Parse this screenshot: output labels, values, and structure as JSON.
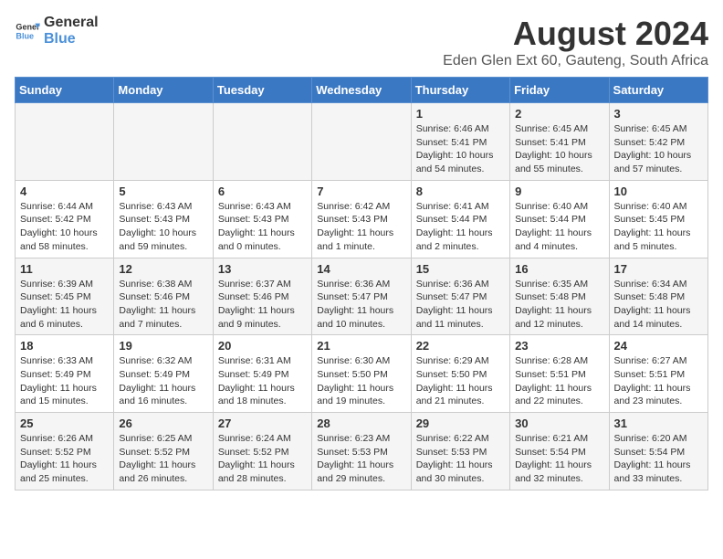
{
  "header": {
    "logo_general": "General",
    "logo_blue": "Blue",
    "month_title": "August 2024",
    "location": "Eden Glen Ext 60, Gauteng, South Africa"
  },
  "days_of_week": [
    "Sunday",
    "Monday",
    "Tuesday",
    "Wednesday",
    "Thursday",
    "Friday",
    "Saturday"
  ],
  "weeks": [
    [
      {
        "day": "",
        "info": ""
      },
      {
        "day": "",
        "info": ""
      },
      {
        "day": "",
        "info": ""
      },
      {
        "day": "",
        "info": ""
      },
      {
        "day": "1",
        "info": "Sunrise: 6:46 AM\nSunset: 5:41 PM\nDaylight: 10 hours and 54 minutes."
      },
      {
        "day": "2",
        "info": "Sunrise: 6:45 AM\nSunset: 5:41 PM\nDaylight: 10 hours and 55 minutes."
      },
      {
        "day": "3",
        "info": "Sunrise: 6:45 AM\nSunset: 5:42 PM\nDaylight: 10 hours and 57 minutes."
      }
    ],
    [
      {
        "day": "4",
        "info": "Sunrise: 6:44 AM\nSunset: 5:42 PM\nDaylight: 10 hours and 58 minutes."
      },
      {
        "day": "5",
        "info": "Sunrise: 6:43 AM\nSunset: 5:43 PM\nDaylight: 10 hours and 59 minutes."
      },
      {
        "day": "6",
        "info": "Sunrise: 6:43 AM\nSunset: 5:43 PM\nDaylight: 11 hours and 0 minutes."
      },
      {
        "day": "7",
        "info": "Sunrise: 6:42 AM\nSunset: 5:43 PM\nDaylight: 11 hours and 1 minute."
      },
      {
        "day": "8",
        "info": "Sunrise: 6:41 AM\nSunset: 5:44 PM\nDaylight: 11 hours and 2 minutes."
      },
      {
        "day": "9",
        "info": "Sunrise: 6:40 AM\nSunset: 5:44 PM\nDaylight: 11 hours and 4 minutes."
      },
      {
        "day": "10",
        "info": "Sunrise: 6:40 AM\nSunset: 5:45 PM\nDaylight: 11 hours and 5 minutes."
      }
    ],
    [
      {
        "day": "11",
        "info": "Sunrise: 6:39 AM\nSunset: 5:45 PM\nDaylight: 11 hours and 6 minutes."
      },
      {
        "day": "12",
        "info": "Sunrise: 6:38 AM\nSunset: 5:46 PM\nDaylight: 11 hours and 7 minutes."
      },
      {
        "day": "13",
        "info": "Sunrise: 6:37 AM\nSunset: 5:46 PM\nDaylight: 11 hours and 9 minutes."
      },
      {
        "day": "14",
        "info": "Sunrise: 6:36 AM\nSunset: 5:47 PM\nDaylight: 11 hours and 10 minutes."
      },
      {
        "day": "15",
        "info": "Sunrise: 6:36 AM\nSunset: 5:47 PM\nDaylight: 11 hours and 11 minutes."
      },
      {
        "day": "16",
        "info": "Sunrise: 6:35 AM\nSunset: 5:48 PM\nDaylight: 11 hours and 12 minutes."
      },
      {
        "day": "17",
        "info": "Sunrise: 6:34 AM\nSunset: 5:48 PM\nDaylight: 11 hours and 14 minutes."
      }
    ],
    [
      {
        "day": "18",
        "info": "Sunrise: 6:33 AM\nSunset: 5:49 PM\nDaylight: 11 hours and 15 minutes."
      },
      {
        "day": "19",
        "info": "Sunrise: 6:32 AM\nSunset: 5:49 PM\nDaylight: 11 hours and 16 minutes."
      },
      {
        "day": "20",
        "info": "Sunrise: 6:31 AM\nSunset: 5:49 PM\nDaylight: 11 hours and 18 minutes."
      },
      {
        "day": "21",
        "info": "Sunrise: 6:30 AM\nSunset: 5:50 PM\nDaylight: 11 hours and 19 minutes."
      },
      {
        "day": "22",
        "info": "Sunrise: 6:29 AM\nSunset: 5:50 PM\nDaylight: 11 hours and 21 minutes."
      },
      {
        "day": "23",
        "info": "Sunrise: 6:28 AM\nSunset: 5:51 PM\nDaylight: 11 hours and 22 minutes."
      },
      {
        "day": "24",
        "info": "Sunrise: 6:27 AM\nSunset: 5:51 PM\nDaylight: 11 hours and 23 minutes."
      }
    ],
    [
      {
        "day": "25",
        "info": "Sunrise: 6:26 AM\nSunset: 5:52 PM\nDaylight: 11 hours and 25 minutes."
      },
      {
        "day": "26",
        "info": "Sunrise: 6:25 AM\nSunset: 5:52 PM\nDaylight: 11 hours and 26 minutes."
      },
      {
        "day": "27",
        "info": "Sunrise: 6:24 AM\nSunset: 5:52 PM\nDaylight: 11 hours and 28 minutes."
      },
      {
        "day": "28",
        "info": "Sunrise: 6:23 AM\nSunset: 5:53 PM\nDaylight: 11 hours and 29 minutes."
      },
      {
        "day": "29",
        "info": "Sunrise: 6:22 AM\nSunset: 5:53 PM\nDaylight: 11 hours and 30 minutes."
      },
      {
        "day": "30",
        "info": "Sunrise: 6:21 AM\nSunset: 5:54 PM\nDaylight: 11 hours and 32 minutes."
      },
      {
        "day": "31",
        "info": "Sunrise: 6:20 AM\nSunset: 5:54 PM\nDaylight: 11 hours and 33 minutes."
      }
    ]
  ]
}
